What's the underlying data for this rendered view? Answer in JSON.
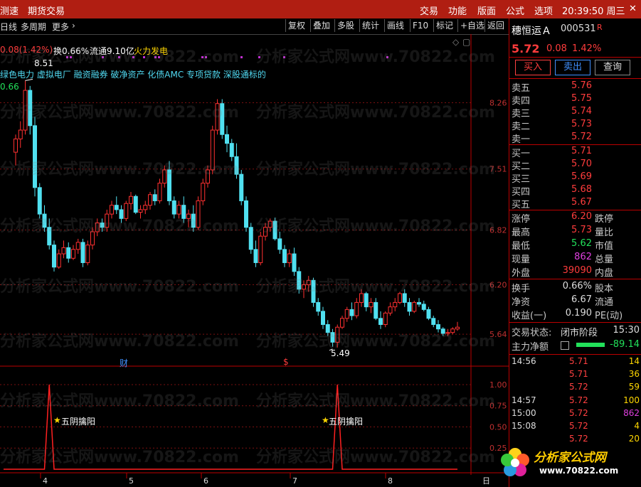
{
  "menu": {
    "speed": "测速",
    "futures": "期货交易",
    "trade": "交易",
    "func": "功能",
    "layout": "版面",
    "formula": "公式",
    "options": "选项",
    "time": "20:39:50 周三",
    "close": "✕"
  },
  "toolbar": {
    "day": "日线",
    "multi": "多周期",
    "more": "更多",
    "more_arrow": "›",
    "restore": "复权",
    "overlay": "叠加",
    "multistock": "多股",
    "stats": "统计",
    "draw": "画线",
    "f10": "F10",
    "mark": "标记",
    "addfav": "+自选",
    "back": "返回"
  },
  "info": {
    "change": "0.08(1.42%)",
    "turnover": "换0.66%",
    "float": "流通9.10亿",
    "concept": "火力发电",
    "concepts2": "绿色电力  虚拟电厂  融资融券  破净资产  化债AMC  专项贷款  深股通标的",
    "open_label": "0.66",
    "high_mark": "8.51",
    "low_mark": "5.49"
  },
  "axis": {
    "price": [
      "8.26",
      "7.51",
      "6.82",
      "6.20",
      "5.64"
    ],
    "ind": [
      "1.00",
      "0.75",
      "0.50",
      "0.25"
    ],
    "months": [
      "4",
      "5",
      "6",
      "7",
      "8"
    ],
    "bottom_right": "日"
  },
  "events": {
    "cai": "财",
    "s": "$"
  },
  "indicator": {
    "label1": "五阴擒阳",
    "label2": "五阴擒阳",
    "star": "★"
  },
  "chart_data": {
    "type": "candlestick",
    "ylim": [
      5.4,
      8.65
    ],
    "high": 8.51,
    "low": 5.49,
    "candles": [
      [
        7.7,
        7.9,
        7.55,
        7.85
      ],
      [
        7.85,
        8.05,
        7.75,
        7.95
      ],
      [
        7.95,
        8.51,
        7.9,
        8.4
      ],
      [
        8.4,
        8.45,
        7.9,
        8.0
      ],
      [
        8.0,
        8.1,
        7.2,
        7.3
      ],
      [
        7.3,
        7.35,
        6.95,
        7.0
      ],
      [
        7.0,
        7.1,
        6.8,
        6.85
      ],
      [
        6.85,
        6.95,
        6.6,
        6.65
      ],
      [
        6.65,
        6.7,
        6.35,
        6.4
      ],
      [
        6.4,
        6.6,
        6.38,
        6.55
      ],
      [
        6.55,
        6.7,
        6.5,
        6.62
      ],
      [
        6.62,
        6.68,
        6.45,
        6.5
      ],
      [
        6.5,
        6.65,
        6.48,
        6.6
      ],
      [
        6.6,
        6.72,
        6.55,
        6.68
      ],
      [
        6.68,
        6.72,
        6.4,
        6.45
      ],
      [
        6.45,
        6.7,
        6.42,
        6.65
      ],
      [
        6.65,
        6.85,
        6.6,
        6.8
      ],
      [
        6.8,
        6.95,
        6.75,
        6.9
      ],
      [
        6.9,
        6.95,
        6.8,
        6.85
      ],
      [
        6.85,
        7.05,
        6.8,
        7.0
      ],
      [
        7.0,
        7.15,
        6.95,
        7.1
      ],
      [
        7.1,
        7.2,
        7.0,
        7.05
      ],
      [
        7.05,
        7.1,
        6.9,
        6.95
      ],
      [
        6.95,
        7.15,
        6.92,
        7.12
      ],
      [
        7.12,
        7.25,
        7.05,
        7.2
      ],
      [
        7.2,
        7.22,
        7.0,
        7.02
      ],
      [
        7.02,
        7.1,
        6.95,
        7.05
      ],
      [
        7.05,
        7.15,
        7.0,
        7.1
      ],
      [
        7.1,
        7.25,
        7.05,
        7.22
      ],
      [
        7.22,
        7.28,
        7.1,
        7.15
      ],
      [
        7.15,
        7.4,
        7.12,
        7.35
      ],
      [
        7.35,
        7.55,
        7.3,
        7.5
      ],
      [
        7.5,
        7.6,
        7.1,
        7.15
      ],
      [
        7.15,
        7.2,
        6.95,
        7.0
      ],
      [
        7.0,
        7.15,
        6.95,
        7.1
      ],
      [
        7.1,
        7.2,
        6.9,
        6.95
      ],
      [
        6.95,
        7.05,
        6.85,
        7.0
      ],
      [
        7.0,
        7.1,
        6.8,
        6.85
      ],
      [
        6.85,
        7.2,
        6.82,
        7.15
      ],
      [
        7.15,
        7.4,
        7.1,
        7.35
      ],
      [
        7.35,
        7.55,
        7.3,
        7.5
      ],
      [
        7.5,
        8.0,
        7.45,
        7.95
      ],
      [
        7.95,
        8.3,
        7.9,
        8.25
      ],
      [
        8.25,
        8.3,
        7.85,
        7.9
      ],
      [
        7.9,
        8.0,
        7.7,
        7.8
      ],
      [
        7.8,
        7.85,
        7.6,
        7.65
      ],
      [
        7.65,
        7.8,
        7.4,
        7.45
      ],
      [
        7.45,
        7.5,
        7.1,
        7.15
      ],
      [
        7.15,
        7.2,
        6.8,
        6.85
      ],
      [
        6.85,
        6.9,
        6.55,
        6.6
      ],
      [
        6.6,
        6.7,
        6.4,
        6.45
      ],
      [
        6.45,
        6.8,
        6.42,
        6.75
      ],
      [
        6.75,
        6.9,
        6.7,
        6.85
      ],
      [
        6.85,
        6.95,
        6.8,
        6.92
      ],
      [
        6.92,
        6.96,
        6.7,
        6.72
      ],
      [
        6.72,
        6.8,
        6.55,
        6.6
      ],
      [
        6.6,
        6.65,
        6.4,
        6.45
      ],
      [
        6.45,
        6.6,
        6.4,
        6.55
      ],
      [
        6.55,
        6.62,
        6.3,
        6.35
      ],
      [
        6.35,
        6.4,
        6.1,
        6.15
      ],
      [
        6.15,
        6.25,
        6.05,
        6.2
      ],
      [
        6.2,
        6.3,
        6.12,
        6.25
      ],
      [
        6.25,
        6.28,
        5.95,
        6.0
      ],
      [
        6.0,
        6.05,
        5.85,
        5.9
      ],
      [
        5.9,
        5.95,
        5.7,
        5.75
      ],
      [
        5.75,
        5.8,
        5.62,
        5.66
      ],
      [
        5.66,
        5.7,
        5.5,
        5.55
      ],
      [
        5.55,
        5.75,
        5.49,
        5.72
      ],
      [
        5.72,
        5.85,
        5.7,
        5.82
      ],
      [
        5.82,
        5.95,
        5.78,
        5.92
      ],
      [
        5.92,
        6.0,
        5.8,
        5.85
      ],
      [
        5.85,
        6.05,
        5.82,
        6.0
      ],
      [
        6.0,
        6.15,
        5.95,
        6.1
      ],
      [
        6.1,
        6.12,
        5.9,
        5.95
      ],
      [
        5.95,
        6.05,
        5.88,
        6.0
      ],
      [
        6.0,
        6.05,
        5.8,
        5.82
      ],
      [
        5.82,
        5.9,
        5.7,
        5.75
      ],
      [
        5.75,
        5.9,
        5.72,
        5.88
      ],
      [
        5.88,
        6.0,
        5.85,
        5.95
      ],
      [
        5.95,
        6.05,
        5.9,
        6.0
      ],
      [
        6.0,
        6.12,
        5.98,
        6.1
      ],
      [
        6.1,
        6.15,
        5.95,
        6.0
      ],
      [
        6.0,
        6.05,
        5.85,
        5.9
      ],
      [
        5.9,
        6.02,
        5.88,
        6.0
      ],
      [
        6.0,
        6.05,
        5.95,
        5.98
      ],
      [
        5.98,
        6.02,
        5.9,
        5.92
      ],
      [
        5.92,
        5.95,
        5.8,
        5.82
      ],
      [
        5.82,
        5.85,
        5.72,
        5.75
      ],
      [
        5.75,
        5.8,
        5.66,
        5.7
      ],
      [
        5.7,
        5.72,
        5.62,
        5.65
      ],
      [
        5.65,
        5.7,
        5.62,
        5.66
      ],
      [
        5.66,
        5.72,
        5.64,
        5.7
      ],
      [
        5.7,
        5.78,
        5.68,
        5.72
      ]
    ],
    "indicator": {
      "name": "五阴擒阳",
      "ylim": [
        0,
        1.05
      ],
      "signals": [
        {
          "index": 7,
          "value": 1.0
        },
        {
          "index": 67,
          "value": 1.0
        }
      ]
    }
  },
  "quote": {
    "name": "穗恒运Ａ",
    "code": "000531",
    "flag": "R",
    "price": "5.72",
    "change": "0.08",
    "pct": "1.42%"
  },
  "buttons": {
    "buy": "买入",
    "sell": "卖出",
    "query": "查询"
  },
  "asks": [
    {
      "label": "卖五",
      "price": "5.76"
    },
    {
      "label": "卖四",
      "price": "5.75"
    },
    {
      "label": "卖三",
      "price": "5.74"
    },
    {
      "label": "卖二",
      "price": "5.73"
    },
    {
      "label": "卖一",
      "price": "5.72"
    }
  ],
  "bids": [
    {
      "label": "买一",
      "price": "5.71"
    },
    {
      "label": "买二",
      "price": "5.70"
    },
    {
      "label": "买三",
      "price": "5.69"
    },
    {
      "label": "买四",
      "price": "5.68"
    },
    {
      "label": "买五",
      "price": "5.67"
    }
  ],
  "stats": [
    {
      "l": "涨停",
      "v": "6.20",
      "r": "跌停"
    },
    {
      "l": "最高",
      "v": "5.73",
      "r": "量比"
    },
    {
      "l": "最低",
      "v": "5.62",
      "r": "市值"
    },
    {
      "l": "现量",
      "v": "862",
      "r": "总量"
    },
    {
      "l": "外盘",
      "v": "39090",
      "r": "内盘"
    }
  ],
  "stats2": [
    {
      "l": "换手",
      "v": "0.66%",
      "r": "股本"
    },
    {
      "l": "净资",
      "v": "6.67",
      "r": "流通"
    },
    {
      "l": "收益(一)",
      "v": "0.190",
      "r": "PE(动)"
    }
  ],
  "status": {
    "label": "交易状态:",
    "value": "闭市阶段",
    "time": "15:30"
  },
  "mainflow": {
    "label": "主力净额",
    "value": "-89.14"
  },
  "trades": [
    {
      "t": "14:56",
      "p": "5.71",
      "q": "14"
    },
    {
      "t": "",
      "p": "5.71",
      "q": "36"
    },
    {
      "t": "",
      "p": "5.72",
      "q": "59"
    },
    {
      "t": "14:57",
      "p": "5.72",
      "q": "100"
    },
    {
      "t": "15:00",
      "p": "5.72",
      "q": "862"
    },
    {
      "t": "15:08",
      "p": "5.72",
      "q": "4"
    },
    {
      "t": "",
      "p": "5.72",
      "q": "20"
    }
  ],
  "logo": {
    "text": "分析家公式网",
    "url": "www.70822.com"
  },
  "watermark": "分析家公式网www.70822.com"
}
